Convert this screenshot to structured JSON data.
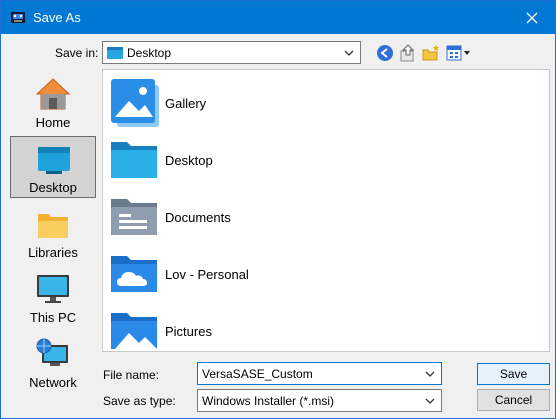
{
  "window": {
    "title": "Save As"
  },
  "toolbar": {
    "save_in_label": "Save in:",
    "save_in_value": "Desktop"
  },
  "places": [
    {
      "label": "Home",
      "icon": "home-icon"
    },
    {
      "label": "Desktop",
      "icon": "desktop-icon",
      "selected": true
    },
    {
      "label": "Libraries",
      "icon": "libraries-icon"
    },
    {
      "label": "This PC",
      "icon": "this-pc-icon"
    },
    {
      "label": "Network",
      "icon": "network-icon"
    }
  ],
  "files": [
    {
      "name": "Gallery",
      "icon": "gallery-folder-icon"
    },
    {
      "name": "Desktop",
      "icon": "desktop-folder-icon"
    },
    {
      "name": "Documents",
      "icon": "documents-folder-icon"
    },
    {
      "name": "Lov - Personal",
      "icon": "onedrive-folder-icon"
    },
    {
      "name": "Pictures",
      "icon": "pictures-folder-icon"
    }
  ],
  "form": {
    "filename_label": "File name:",
    "filename_value": "VersaSASE_Custom",
    "type_label": "Save as type:",
    "type_value": "Windows Installer (*.msi)"
  },
  "buttons": {
    "save": "Save",
    "cancel": "Cancel"
  },
  "colors": {
    "titlebar": "#0078d4",
    "folder_blue": "#1e88e5",
    "folder_light": "#4fc3f7"
  }
}
